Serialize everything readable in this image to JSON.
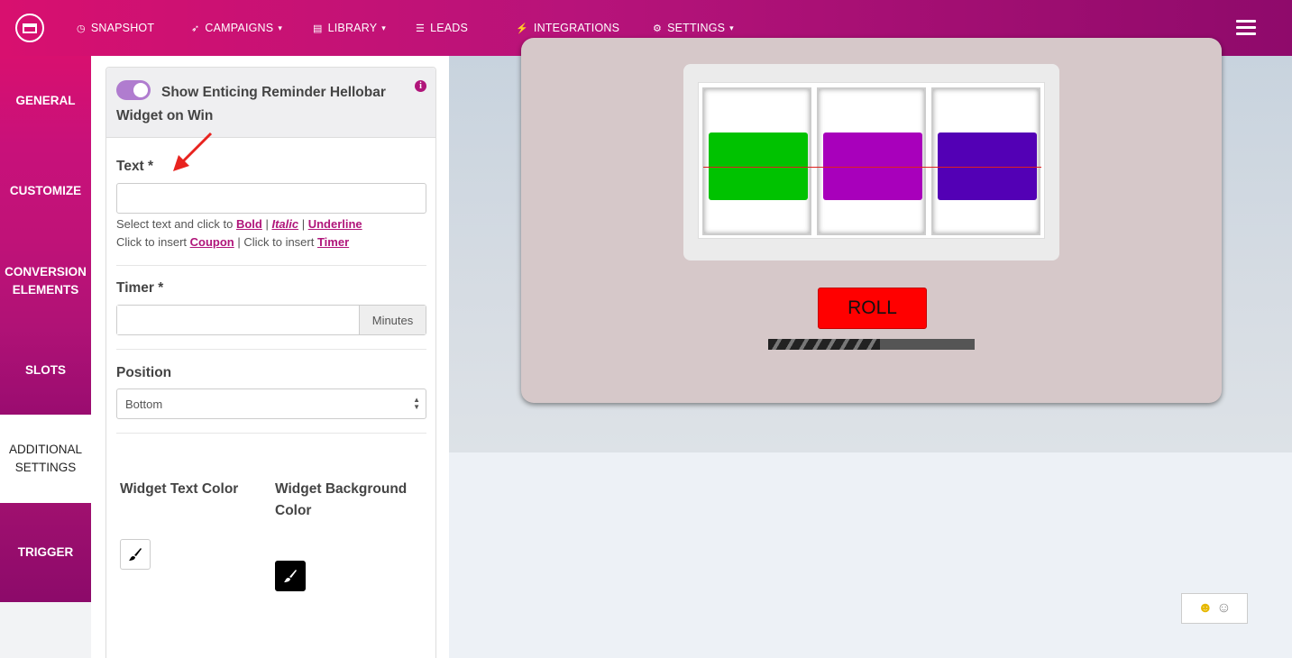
{
  "nav": {
    "items": [
      {
        "icon": "dashboard-icon",
        "glyph": "◷",
        "label": "SNAPSHOT",
        "caret": false
      },
      {
        "icon": "paper-plane-icon",
        "glyph": "➶",
        "label": "CAMPAIGNS",
        "caret": true
      },
      {
        "icon": "library-icon",
        "glyph": "▤",
        "label": "LIBRARY",
        "caret": true
      },
      {
        "icon": "list-icon",
        "glyph": "☰",
        "label": "LEADS",
        "caret": false
      },
      {
        "icon": "plug-icon",
        "glyph": "⚡",
        "label": "INTEGRATIONS",
        "caret": false
      },
      {
        "icon": "cogs-icon",
        "glyph": "⚙",
        "label": "SETTINGS",
        "caret": true
      }
    ],
    "caret_glyph": "▾"
  },
  "sidebar": {
    "tabs": [
      {
        "label": "GENERAL",
        "active": false
      },
      {
        "label": "CUSTOMIZE",
        "active": false
      },
      {
        "label": "CONVERSION ELEMENTS",
        "active": false
      },
      {
        "label": "SLOTS",
        "active": false
      },
      {
        "label": "ADDITIONAL SETTINGS",
        "active": true
      },
      {
        "label": "TRIGGER",
        "active": false
      }
    ]
  },
  "panel": {
    "toggle": {
      "label": "Show Enticing Reminder Hellobar Widget on Win",
      "on": true,
      "info_glyph": "i"
    },
    "text_field": {
      "label": "Text *",
      "value": ""
    },
    "help": {
      "line1_prefix": "Select text and click to ",
      "bold": "Bold",
      "sep": " | ",
      "italic": "Italic",
      "underline": "Underline",
      "line2_prefix": "Click to insert ",
      "coupon": "Coupon",
      "line2_mid": " | Click to insert ",
      "timer": "Timer"
    },
    "timer_field": {
      "label": "Timer *",
      "value": "",
      "addon": "Minutes"
    },
    "position_field": {
      "label": "Position",
      "selected": "Bottom"
    },
    "colors": {
      "text_color_label": "Widget Text Color",
      "bg_color_label": "Widget Background Color"
    }
  },
  "preview": {
    "reels": [
      {
        "color": "#00c200"
      },
      {
        "color": "#a800bb"
      },
      {
        "color": "#5300b5"
      }
    ],
    "roll_label": "ROLL",
    "progress": 0.54,
    "emoji_glyph": "☺"
  },
  "colors": {
    "brand": "#c4127a",
    "brand_dark": "#8f0a6b",
    "tab_gradient_top": "#d8106f",
    "tab_gradient_bottom": "#8f0a6b",
    "roll_button": "#ff0000"
  }
}
